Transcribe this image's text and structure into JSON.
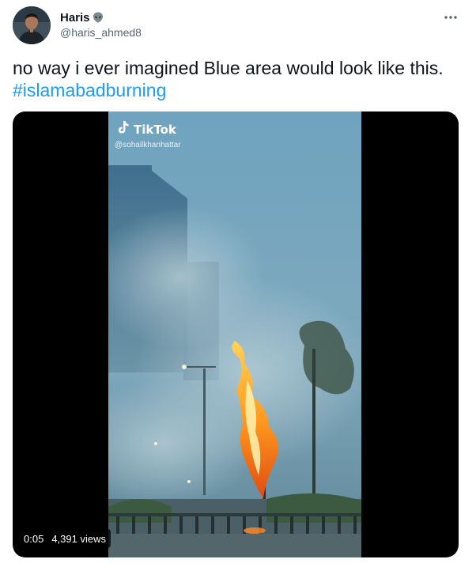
{
  "tweet": {
    "author": {
      "display_name": "Haris",
      "name_emoji_icon": "alien-icon",
      "handle": "@haris_ahmed8"
    },
    "more_icon": "more-icon",
    "text": "no way i ever imagined Blue area would look like this.",
    "hashtag": "#islamabadburning",
    "media": {
      "watermark_brand": "TikTok",
      "watermark_user": "@sohailkhanhattar",
      "time": "0:05",
      "views": "4,391 views"
    }
  },
  "colors": {
    "text": "#0f1419",
    "secondary_text": "#536471",
    "link": "#1d9bf0",
    "media_background": "#000000"
  }
}
